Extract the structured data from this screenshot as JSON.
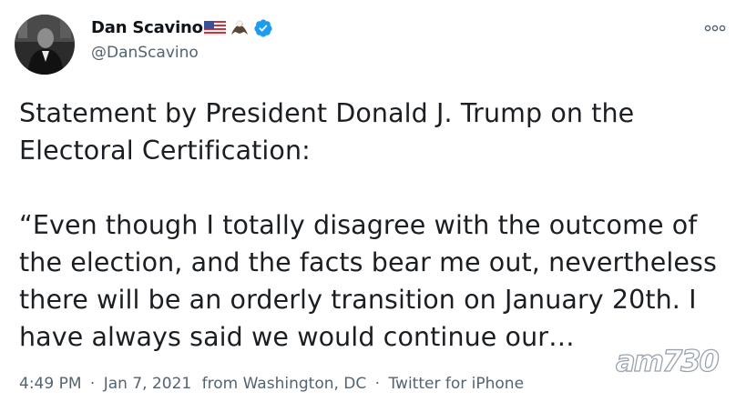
{
  "user": {
    "display_name": "Dan Scavino",
    "handle": "@DanScavino",
    "emoji": [
      "flag-united-states",
      "eagle"
    ],
    "verified": true
  },
  "tweet": {
    "paragraph_1": "Statement by President Donald J. Trump on the Electoral Certification:",
    "paragraph_2": "“Even though I totally disagree with the outcome of the election, and the facts bear me out, nevertheless there will be an orderly transition on January 20th. I have always said we would continue our…"
  },
  "meta": {
    "time": "4:49 PM",
    "separator": "·",
    "date": "Jan 7, 2021",
    "location": "from Washington, DC",
    "source": "Twitter for iPhone"
  },
  "watermark": {
    "text": "am730"
  },
  "colors": {
    "text": "#0f1419",
    "secondary": "#536471",
    "verified": "#1d9bf0"
  }
}
